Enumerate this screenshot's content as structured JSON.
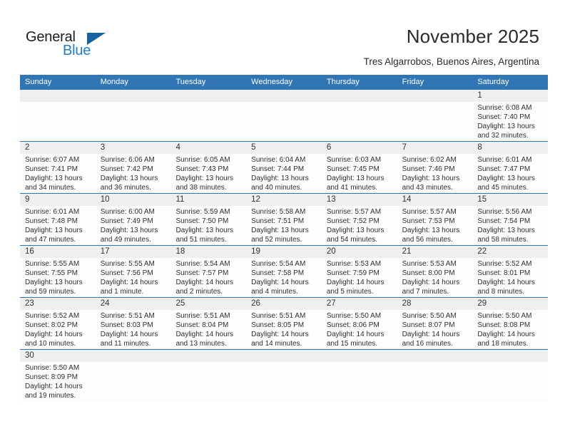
{
  "brand": {
    "name_part1": "General",
    "name_part2": "Blue",
    "accent_color": "#1f7fc4",
    "triangle_color": "#15639f"
  },
  "header": {
    "title": "November 2025",
    "subtitle": "Tres Algarrobos, Buenos Aires, Argentina"
  },
  "calendar": {
    "header_bg": "#3275b5",
    "day_band_bg": "#efefef",
    "weekdays": [
      "Sunday",
      "Monday",
      "Tuesday",
      "Wednesday",
      "Thursday",
      "Friday",
      "Saturday"
    ],
    "weeks": [
      [
        {
          "day": "",
          "sunrise": "",
          "sunset": "",
          "daylight": "",
          "empty": true
        },
        {
          "day": "",
          "sunrise": "",
          "sunset": "",
          "daylight": "",
          "empty": true
        },
        {
          "day": "",
          "sunrise": "",
          "sunset": "",
          "daylight": "",
          "empty": true
        },
        {
          "day": "",
          "sunrise": "",
          "sunset": "",
          "daylight": "",
          "empty": true
        },
        {
          "day": "",
          "sunrise": "",
          "sunset": "",
          "daylight": "",
          "empty": true
        },
        {
          "day": "",
          "sunrise": "",
          "sunset": "",
          "daylight": "",
          "empty": true
        },
        {
          "day": "1",
          "sunrise": "Sunrise: 6:08 AM",
          "sunset": "Sunset: 7:40 PM",
          "daylight": "Daylight: 13 hours and 32 minutes.",
          "empty": false
        }
      ],
      [
        {
          "day": "2",
          "sunrise": "Sunrise: 6:07 AM",
          "sunset": "Sunset: 7:41 PM",
          "daylight": "Daylight: 13 hours and 34 minutes.",
          "empty": false
        },
        {
          "day": "3",
          "sunrise": "Sunrise: 6:06 AM",
          "sunset": "Sunset: 7:42 PM",
          "daylight": "Daylight: 13 hours and 36 minutes.",
          "empty": false
        },
        {
          "day": "4",
          "sunrise": "Sunrise: 6:05 AM",
          "sunset": "Sunset: 7:43 PM",
          "daylight": "Daylight: 13 hours and 38 minutes.",
          "empty": false
        },
        {
          "day": "5",
          "sunrise": "Sunrise: 6:04 AM",
          "sunset": "Sunset: 7:44 PM",
          "daylight": "Daylight: 13 hours and 40 minutes.",
          "empty": false
        },
        {
          "day": "6",
          "sunrise": "Sunrise: 6:03 AM",
          "sunset": "Sunset: 7:45 PM",
          "daylight": "Daylight: 13 hours and 41 minutes.",
          "empty": false
        },
        {
          "day": "7",
          "sunrise": "Sunrise: 6:02 AM",
          "sunset": "Sunset: 7:46 PM",
          "daylight": "Daylight: 13 hours and 43 minutes.",
          "empty": false
        },
        {
          "day": "8",
          "sunrise": "Sunrise: 6:01 AM",
          "sunset": "Sunset: 7:47 PM",
          "daylight": "Daylight: 13 hours and 45 minutes.",
          "empty": false
        }
      ],
      [
        {
          "day": "9",
          "sunrise": "Sunrise: 6:01 AM",
          "sunset": "Sunset: 7:48 PM",
          "daylight": "Daylight: 13 hours and 47 minutes.",
          "empty": false
        },
        {
          "day": "10",
          "sunrise": "Sunrise: 6:00 AM",
          "sunset": "Sunset: 7:49 PM",
          "daylight": "Daylight: 13 hours and 49 minutes.",
          "empty": false
        },
        {
          "day": "11",
          "sunrise": "Sunrise: 5:59 AM",
          "sunset": "Sunset: 7:50 PM",
          "daylight": "Daylight: 13 hours and 51 minutes.",
          "empty": false
        },
        {
          "day": "12",
          "sunrise": "Sunrise: 5:58 AM",
          "sunset": "Sunset: 7:51 PM",
          "daylight": "Daylight: 13 hours and 52 minutes.",
          "empty": false
        },
        {
          "day": "13",
          "sunrise": "Sunrise: 5:57 AM",
          "sunset": "Sunset: 7:52 PM",
          "daylight": "Daylight: 13 hours and 54 minutes.",
          "empty": false
        },
        {
          "day": "14",
          "sunrise": "Sunrise: 5:57 AM",
          "sunset": "Sunset: 7:53 PM",
          "daylight": "Daylight: 13 hours and 56 minutes.",
          "empty": false
        },
        {
          "day": "15",
          "sunrise": "Sunrise: 5:56 AM",
          "sunset": "Sunset: 7:54 PM",
          "daylight": "Daylight: 13 hours and 58 minutes.",
          "empty": false
        }
      ],
      [
        {
          "day": "16",
          "sunrise": "Sunrise: 5:55 AM",
          "sunset": "Sunset: 7:55 PM",
          "daylight": "Daylight: 13 hours and 59 minutes.",
          "empty": false
        },
        {
          "day": "17",
          "sunrise": "Sunrise: 5:55 AM",
          "sunset": "Sunset: 7:56 PM",
          "daylight": "Daylight: 14 hours and 1 minute.",
          "empty": false
        },
        {
          "day": "18",
          "sunrise": "Sunrise: 5:54 AM",
          "sunset": "Sunset: 7:57 PM",
          "daylight": "Daylight: 14 hours and 2 minutes.",
          "empty": false
        },
        {
          "day": "19",
          "sunrise": "Sunrise: 5:54 AM",
          "sunset": "Sunset: 7:58 PM",
          "daylight": "Daylight: 14 hours and 4 minutes.",
          "empty": false
        },
        {
          "day": "20",
          "sunrise": "Sunrise: 5:53 AM",
          "sunset": "Sunset: 7:59 PM",
          "daylight": "Daylight: 14 hours and 5 minutes.",
          "empty": false
        },
        {
          "day": "21",
          "sunrise": "Sunrise: 5:53 AM",
          "sunset": "Sunset: 8:00 PM",
          "daylight": "Daylight: 14 hours and 7 minutes.",
          "empty": false
        },
        {
          "day": "22",
          "sunrise": "Sunrise: 5:52 AM",
          "sunset": "Sunset: 8:01 PM",
          "daylight": "Daylight: 14 hours and 8 minutes.",
          "empty": false
        }
      ],
      [
        {
          "day": "23",
          "sunrise": "Sunrise: 5:52 AM",
          "sunset": "Sunset: 8:02 PM",
          "daylight": "Daylight: 14 hours and 10 minutes.",
          "empty": false
        },
        {
          "day": "24",
          "sunrise": "Sunrise: 5:51 AM",
          "sunset": "Sunset: 8:03 PM",
          "daylight": "Daylight: 14 hours and 11 minutes.",
          "empty": false
        },
        {
          "day": "25",
          "sunrise": "Sunrise: 5:51 AM",
          "sunset": "Sunset: 8:04 PM",
          "daylight": "Daylight: 14 hours and 13 minutes.",
          "empty": false
        },
        {
          "day": "26",
          "sunrise": "Sunrise: 5:51 AM",
          "sunset": "Sunset: 8:05 PM",
          "daylight": "Daylight: 14 hours and 14 minutes.",
          "empty": false
        },
        {
          "day": "27",
          "sunrise": "Sunrise: 5:50 AM",
          "sunset": "Sunset: 8:06 PM",
          "daylight": "Daylight: 14 hours and 15 minutes.",
          "empty": false
        },
        {
          "day": "28",
          "sunrise": "Sunrise: 5:50 AM",
          "sunset": "Sunset: 8:07 PM",
          "daylight": "Daylight: 14 hours and 16 minutes.",
          "empty": false
        },
        {
          "day": "29",
          "sunrise": "Sunrise: 5:50 AM",
          "sunset": "Sunset: 8:08 PM",
          "daylight": "Daylight: 14 hours and 18 minutes.",
          "empty": false
        }
      ],
      [
        {
          "day": "30",
          "sunrise": "Sunrise: 5:50 AM",
          "sunset": "Sunset: 8:09 PM",
          "daylight": "Daylight: 14 hours and 19 minutes.",
          "empty": false
        },
        {
          "day": "",
          "sunrise": "",
          "sunset": "",
          "daylight": "",
          "empty": true
        },
        {
          "day": "",
          "sunrise": "",
          "sunset": "",
          "daylight": "",
          "empty": true
        },
        {
          "day": "",
          "sunrise": "",
          "sunset": "",
          "daylight": "",
          "empty": true
        },
        {
          "day": "",
          "sunrise": "",
          "sunset": "",
          "daylight": "",
          "empty": true
        },
        {
          "day": "",
          "sunrise": "",
          "sunset": "",
          "daylight": "",
          "empty": true
        },
        {
          "day": "",
          "sunrise": "",
          "sunset": "",
          "daylight": "",
          "empty": true
        }
      ]
    ]
  }
}
